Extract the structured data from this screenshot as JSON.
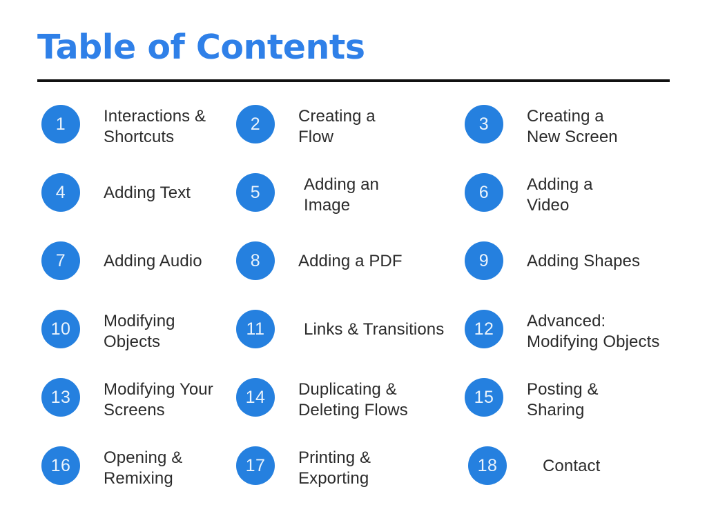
{
  "header": {
    "title": "Table of Contents",
    "rule_color": "#111111",
    "title_color": "#2f80e8"
  },
  "theme": {
    "accent": "#2580df",
    "badge_text_color": "#eaf3fc",
    "label_color": "#2b2b2b",
    "background": "#ffffff"
  },
  "contents": {
    "items": [
      {
        "number": "1",
        "label": "Interactions &\nShortcuts"
      },
      {
        "number": "2",
        "label": "Creating a\nFlow"
      },
      {
        "number": "3",
        "label": "Creating a\nNew Screen"
      },
      {
        "number": "4",
        "label": "Adding Text"
      },
      {
        "number": "5",
        "label": "Adding an\nImage"
      },
      {
        "number": "6",
        "label": "Adding a\nVideo"
      },
      {
        "number": "7",
        "label": "Adding Audio"
      },
      {
        "number": "8",
        "label": "Adding a PDF"
      },
      {
        "number": "9",
        "label": "Adding Shapes"
      },
      {
        "number": "10",
        "label": "Modifying\nObjects"
      },
      {
        "number": "11",
        "label": "Links & Transitions"
      },
      {
        "number": "12",
        "label": "Advanced:\nModifying Objects"
      },
      {
        "number": "13",
        "label": "Modifying Your\nScreens"
      },
      {
        "number": "14",
        "label": "Duplicating &\nDeleting Flows"
      },
      {
        "number": "15",
        "label": "Posting &\nSharing"
      },
      {
        "number": "16",
        "label": "Opening &\nRemixing"
      },
      {
        "number": "17",
        "label": "Printing &\nExporting"
      },
      {
        "number": "18",
        "label": "Contact"
      }
    ]
  }
}
